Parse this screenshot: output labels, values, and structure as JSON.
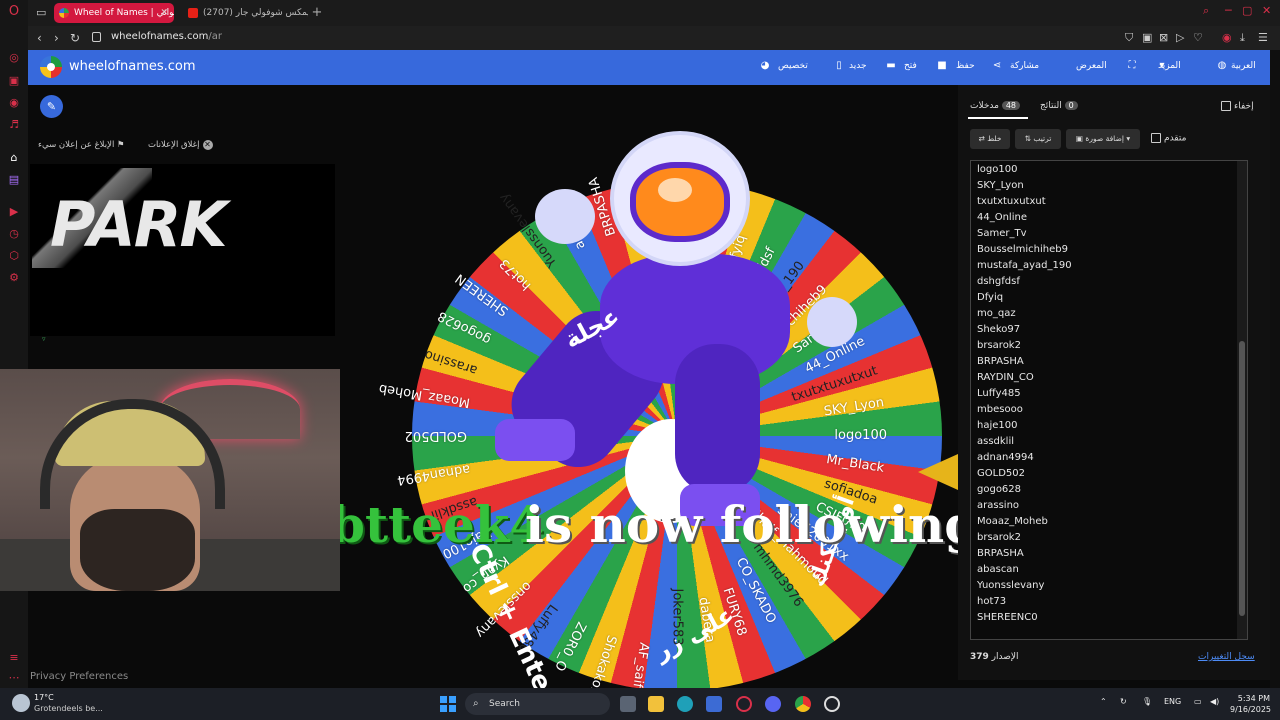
{
  "browser": {
    "tabs": [
      {
        "label": "Wheel of Names | عجلة عشوائي",
        "active": true
      },
      {
        "label": "(2707) ريمكس شوفولي جار...",
        "active": false
      }
    ],
    "url_host": "wheelofnames.com",
    "url_path": "/ar"
  },
  "header": {
    "brand": "wheelofnames.com",
    "menu": {
      "customize": "تخصيص",
      "new": "جديد",
      "open": "فتح",
      "save": "حفظ",
      "share": "مشاركة",
      "gallery": "المعرض",
      "more": "المزيد",
      "language": "العربية"
    }
  },
  "ads": {
    "report": "الإبلاغ عن إعلان سيء",
    "close": "إغلاق الإعلانات",
    "brand": "PARK"
  },
  "privacy": "Privacy Preferences",
  "wheel": {
    "labels": [
      "logo100",
      "SKY_Lyon",
      "txutxtuxutxut",
      "44_Online",
      "Samer_Tv",
      "Bousselmichiheb9",
      "mustafa_ayad_190",
      "dshgfdsf",
      "Dfyiq",
      "mo_qaz",
      "Sheko97",
      "brsarok2",
      "BRPASHA",
      "abascan",
      "Yuonsslevany",
      "hot73",
      "SHEREEN",
      "gogo628",
      "arassino",
      "Moaaz_Moheb",
      "GOLD502",
      "adnan4994",
      "assdklil",
      "haje100",
      "Kyan_co",
      "onsslevany",
      "Luffy486",
      "ZOR0_O",
      "Shokakolat",
      "AF_saif",
      "Joker583",
      "dabera",
      "FURY68",
      "CO_SKADO",
      "mhmd3976",
      "Shaif_Mahmoud",
      "Saied2001xx",
      "CSIF070",
      "sofiadoa",
      "Mr_Black"
    ],
    "overlay_arabic_top": "عجلة",
    "overlay_ctrl": "Ctrl + Enter",
    "overlay_arabic_bottom": "على زر",
    "overlay_arabic_right": "أو يمكنك"
  },
  "follow_alert": {
    "name": "btteek4",
    "text": "is now following!"
  },
  "panel": {
    "hide_label": "إخفاء",
    "tab_entries": {
      "label": "مدخلات",
      "count": "48"
    },
    "tab_results": {
      "label": "النتائج",
      "count": "0"
    },
    "buttons": {
      "shuffle": "خلط",
      "sort": "ترتيب",
      "add_image": "إضافة صورة",
      "advanced": "متقدم"
    },
    "entries": [
      "logo100",
      "SKY_Lyon",
      "txutxtuxutxut",
      "44_Online",
      "Samer_Tv",
      "Bousselmichiheb9",
      "mustafa_ayad_190",
      "dshgfdsf",
      "Dfyiq",
      "mo_qaz",
      "Sheko97",
      "brsarok2",
      "BRPASHA",
      "RAYDIN_CO",
      "Luffy485",
      "mbesooo",
      "haje100",
      "assdklil",
      "adnan4994",
      "GOLD502",
      "gogo628",
      "arassino",
      "Moaaz_Moheb",
      "brsarok2",
      "BRPASHA",
      "abascan",
      "Yuonsslevany",
      "hot73",
      "SHEREENC0"
    ],
    "version_label": "الإصدار",
    "version_number": "379",
    "changelog": "سجل التغييرات"
  },
  "taskbar": {
    "temp": "17°C",
    "weather": "Grotendeels be...",
    "search": "Search",
    "lang": "ENG",
    "time": "5:34 PM",
    "date": "9/16/2025"
  },
  "colors": {
    "accent_blue": "#3769dc",
    "opera_red": "#d3183f",
    "wheel_blue": "#3a6fe0",
    "wheel_red": "#e73232",
    "wheel_yellow": "#f4bf1a",
    "wheel_green": "#2aa34a"
  }
}
